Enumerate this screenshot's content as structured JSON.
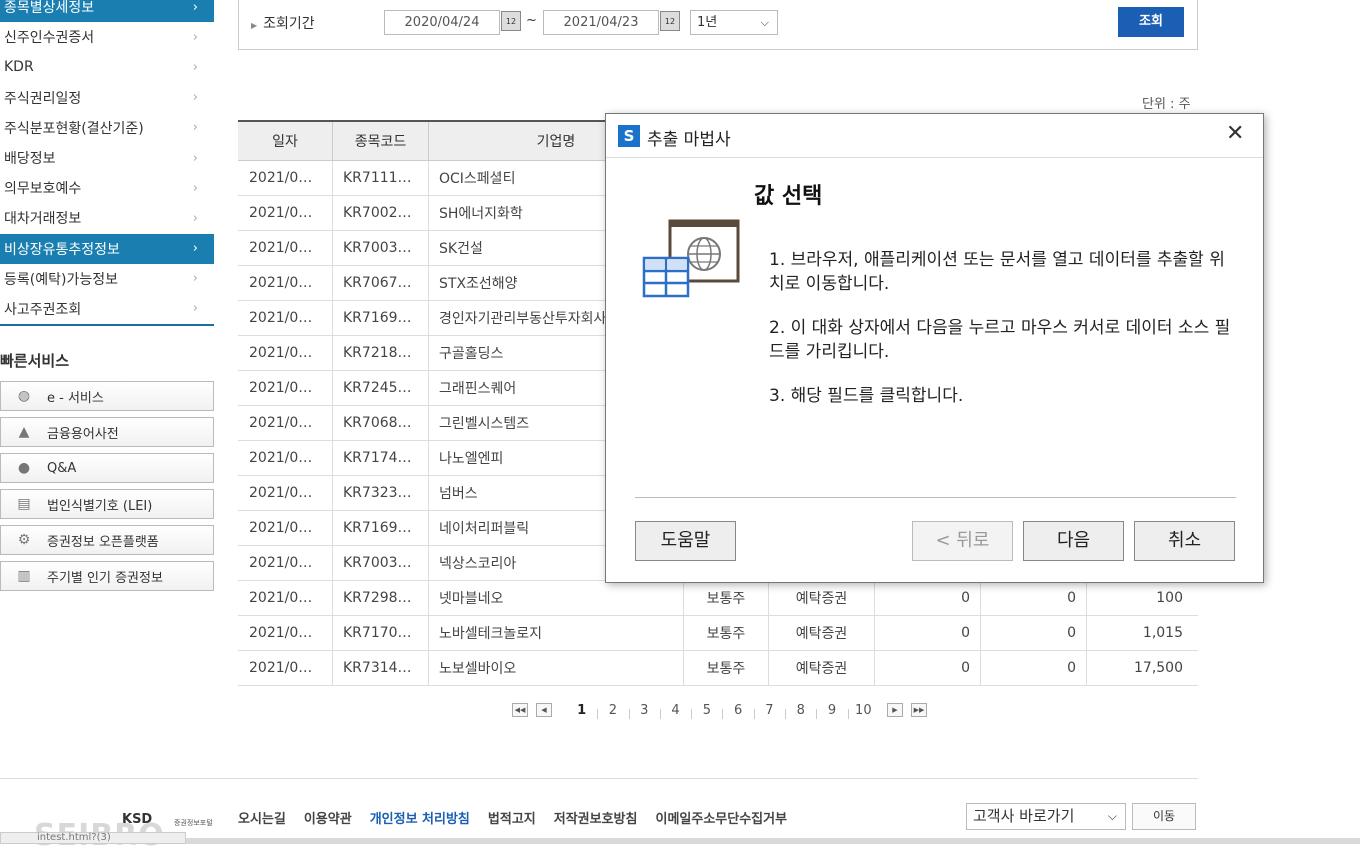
{
  "sidebar": {
    "items": [
      {
        "label": "종목별상세정보",
        "active": true
      },
      {
        "label": "신주인수권증서",
        "active": false
      },
      {
        "label": "KDR",
        "active": false
      },
      {
        "label": "주식권리일정",
        "active": false
      },
      {
        "label": "주식분포현황(결산기준)",
        "active": false
      },
      {
        "label": "배당정보",
        "active": false
      },
      {
        "label": "의무보호예수",
        "active": false
      },
      {
        "label": "대차거래정보",
        "active": false
      },
      {
        "label": "비상장유통추정정보",
        "active": true
      },
      {
        "label": "등록(예탁)가능정보",
        "active": false
      },
      {
        "label": "사고주권조회",
        "active": false
      }
    ],
    "quick_title": "빠른서비스",
    "quick_services": [
      {
        "label": "e - 서비스",
        "icon": "globe-icon"
      },
      {
        "label": "금융용어사전",
        "icon": "graduation-cap-icon"
      },
      {
        "label": "Q&A",
        "icon": "speech-bubble-icon"
      },
      {
        "label": "법인식별기호 (LEI)",
        "icon": "document-search-icon"
      },
      {
        "label": "증권정보 오픈플랫폼",
        "icon": "api-gear-icon"
      },
      {
        "label": "주기별 인기 증권정보",
        "icon": "bar-chart-icon"
      }
    ]
  },
  "search": {
    "label": "조회기간",
    "start_date": "2020/04/24",
    "end_date": "2021/04/23",
    "separator": "~",
    "period": "1년",
    "button": "조회"
  },
  "unit": "단위 : 주",
  "table": {
    "headers": [
      "일자",
      "종목코드",
      "기업명",
      "",
      "",
      "",
      "",
      ""
    ],
    "rows": [
      [
        "2021/0…",
        "KR7111…",
        "OCI스페셜티",
        "",
        "",
        "",
        "",
        ""
      ],
      [
        "2021/0…",
        "KR7002…",
        "SH에너지화학",
        "",
        "",
        "",
        "",
        ""
      ],
      [
        "2021/0…",
        "KR7003…",
        "SK건설",
        "",
        "",
        "",
        "",
        ""
      ],
      [
        "2021/0…",
        "KR7067…",
        "STX조선해양",
        "",
        "",
        "",
        "",
        ""
      ],
      [
        "2021/0…",
        "KR7169…",
        "경인자기관리부동산투자회사",
        "",
        "",
        "",
        "",
        ""
      ],
      [
        "2021/0…",
        "KR7218…",
        "구골홀딩스",
        "",
        "",
        "",
        "",
        ""
      ],
      [
        "2021/0…",
        "KR7245…",
        "그래핀스퀘어",
        "",
        "",
        "",
        "",
        ""
      ],
      [
        "2021/0…",
        "KR7068…",
        "그린벨시스템즈",
        "",
        "",
        "",
        "",
        ""
      ],
      [
        "2021/0…",
        "KR7174…",
        "나노엘엔피",
        "",
        "",
        "",
        "",
        ""
      ],
      [
        "2021/0…",
        "KR7323…",
        "넘버스",
        "",
        "",
        "",
        "",
        ""
      ],
      [
        "2021/0…",
        "KR7169…",
        "네이처리퍼블릭",
        "",
        "",
        "",
        "",
        ""
      ],
      [
        "2021/0…",
        "KR7003…",
        "넥상스코리아",
        "",
        "",
        "",
        "",
        ""
      ],
      [
        "2021/0…",
        "KR7298…",
        "넷마블네오",
        "보통주",
        "예탁증권",
        "0",
        "0",
        "100"
      ],
      [
        "2021/0…",
        "KR7170…",
        "노바셀테크놀로지",
        "보통주",
        "예탁증권",
        "0",
        "0",
        "1,015"
      ],
      [
        "2021/0…",
        "KR7314…",
        "노보셀바이오",
        "보통주",
        "예탁증권",
        "0",
        "0",
        "17,500"
      ]
    ]
  },
  "pagination": {
    "pages": [
      "1",
      "2",
      "3",
      "4",
      "5",
      "6",
      "7",
      "8",
      "9",
      "10"
    ],
    "current": "1"
  },
  "footer": {
    "logo_text": "SEIBRO",
    "ksd": "KSD",
    "ksd_sub": "증권정보포털",
    "links": [
      "오시는길",
      "이용약관",
      "개인정보 처리방침",
      "법적고지",
      "저작권보호방침",
      "이메일주소무단수집거부"
    ],
    "select": "고객사 바로가기",
    "go": "이동",
    "status": "intest.html?(3)"
  },
  "dialog": {
    "title": "추출 마법사",
    "heading": "값 선택",
    "steps": [
      "1. 브라우저, 애플리케이션 또는 문서를 열고 데이터를 추출할 위치로 이동합니다.",
      "2. 이 대화 상자에서 다음을 누르고 마우스 커서로 데이터 소스 필드를 가리킵니다.",
      "3. 해당 필드를 클릭합니다."
    ],
    "help": "도움말",
    "back": "< 뒤로",
    "next": "다음",
    "cancel": "취소"
  },
  "colors": {
    "accent": "#1a7fb0",
    "button": "#1a5fb4",
    "dialog_icon": "#1a73c8"
  }
}
